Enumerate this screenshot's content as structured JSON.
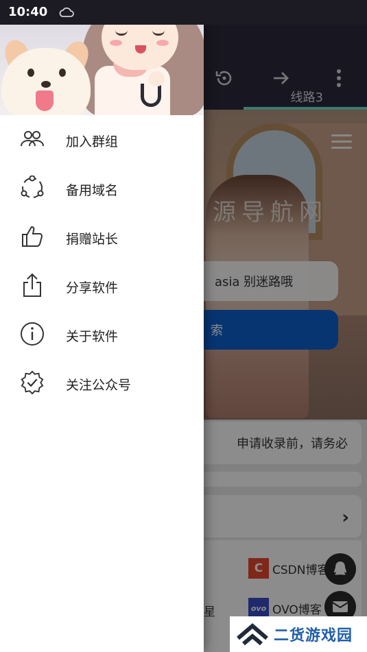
{
  "status_bar": {
    "time": "10:40"
  },
  "background": {
    "tab_label": "线路3",
    "site_title": "源导航网",
    "search_text": "asia 别迷路哦",
    "search_button_label": "索",
    "notice_text": "申请收录前，请务必",
    "links": [
      {
        "logo": "C",
        "label": "CSDN博客",
        "logo_color": "#e8482f"
      },
      {
        "logo": "ovo",
        "label": "OVO博客",
        "logo_color": "#3a4cc4"
      }
    ],
    "partial_text": "星"
  },
  "drawer": {
    "menu": [
      {
        "icon": "group-icon",
        "label": "加入群组"
      },
      {
        "icon": "share-nodes-icon",
        "label": "备用域名"
      },
      {
        "icon": "thumbs-up-icon",
        "label": "捐赠站长"
      },
      {
        "icon": "share-upload-icon",
        "label": "分享软件"
      },
      {
        "icon": "info-icon",
        "label": "关于软件"
      },
      {
        "icon": "verified-badge-icon",
        "label": "关注公众号"
      }
    ]
  },
  "watermark": {
    "text": "二货游戏园"
  },
  "colors": {
    "appbar": "#2d2a3c",
    "accent_tab": "#6fe3c8",
    "search_button": "#0d62d0"
  }
}
